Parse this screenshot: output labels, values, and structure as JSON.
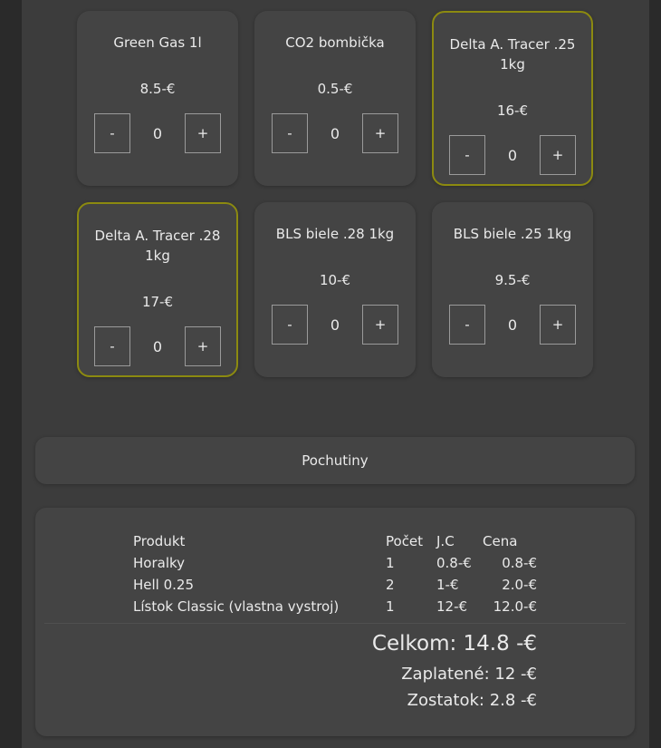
{
  "products": [
    {
      "name": "Green Gas 1l",
      "price": "8.5-€",
      "qty": "0",
      "minus": "-",
      "plus": "+"
    },
    {
      "name": "CO2 bombička",
      "price": "0.5-€",
      "qty": "0",
      "minus": "-",
      "plus": "+"
    },
    {
      "name": "Delta A. Tracer .25 1kg",
      "price": "16-€",
      "qty": "0",
      "minus": "-",
      "plus": "+"
    },
    {
      "name": "Delta A. Tracer .28 1kg",
      "price": "17-€",
      "qty": "0",
      "minus": "-",
      "plus": "+"
    },
    {
      "name": "BLS biele .28 1kg",
      "price": "10-€",
      "qty": "0",
      "minus": "-",
      "plus": "+"
    },
    {
      "name": "BLS biele .25 1kg",
      "price": "9.5-€",
      "qty": "0",
      "minus": "-",
      "plus": "+"
    }
  ],
  "section": {
    "title": "Pochutiny"
  },
  "summary": {
    "headers": {
      "product": "Produkt",
      "count": "Počet",
      "unit": "J.C",
      "price": "Cena"
    },
    "rows": [
      {
        "product": "Horalky",
        "count": "1",
        "unit": "0.8-€",
        "price": "0.8-€"
      },
      {
        "product": "Hell 0.25",
        "count": "2",
        "unit": "1-€",
        "price": "2.0-€"
      },
      {
        "product": "Lístok Classic (vlastna vystroj)",
        "count": "1",
        "unit": "12-€",
        "price": "12.0-€"
      }
    ],
    "total": "Celkom: 14.8 -€",
    "paid": "Zaplatené: 12 -€",
    "remaining": "Zostatok: 2.8 -€"
  },
  "colors": {
    "highlight": "#8c8a10",
    "card": "#444444",
    "panel": "#3c3c3c"
  }
}
